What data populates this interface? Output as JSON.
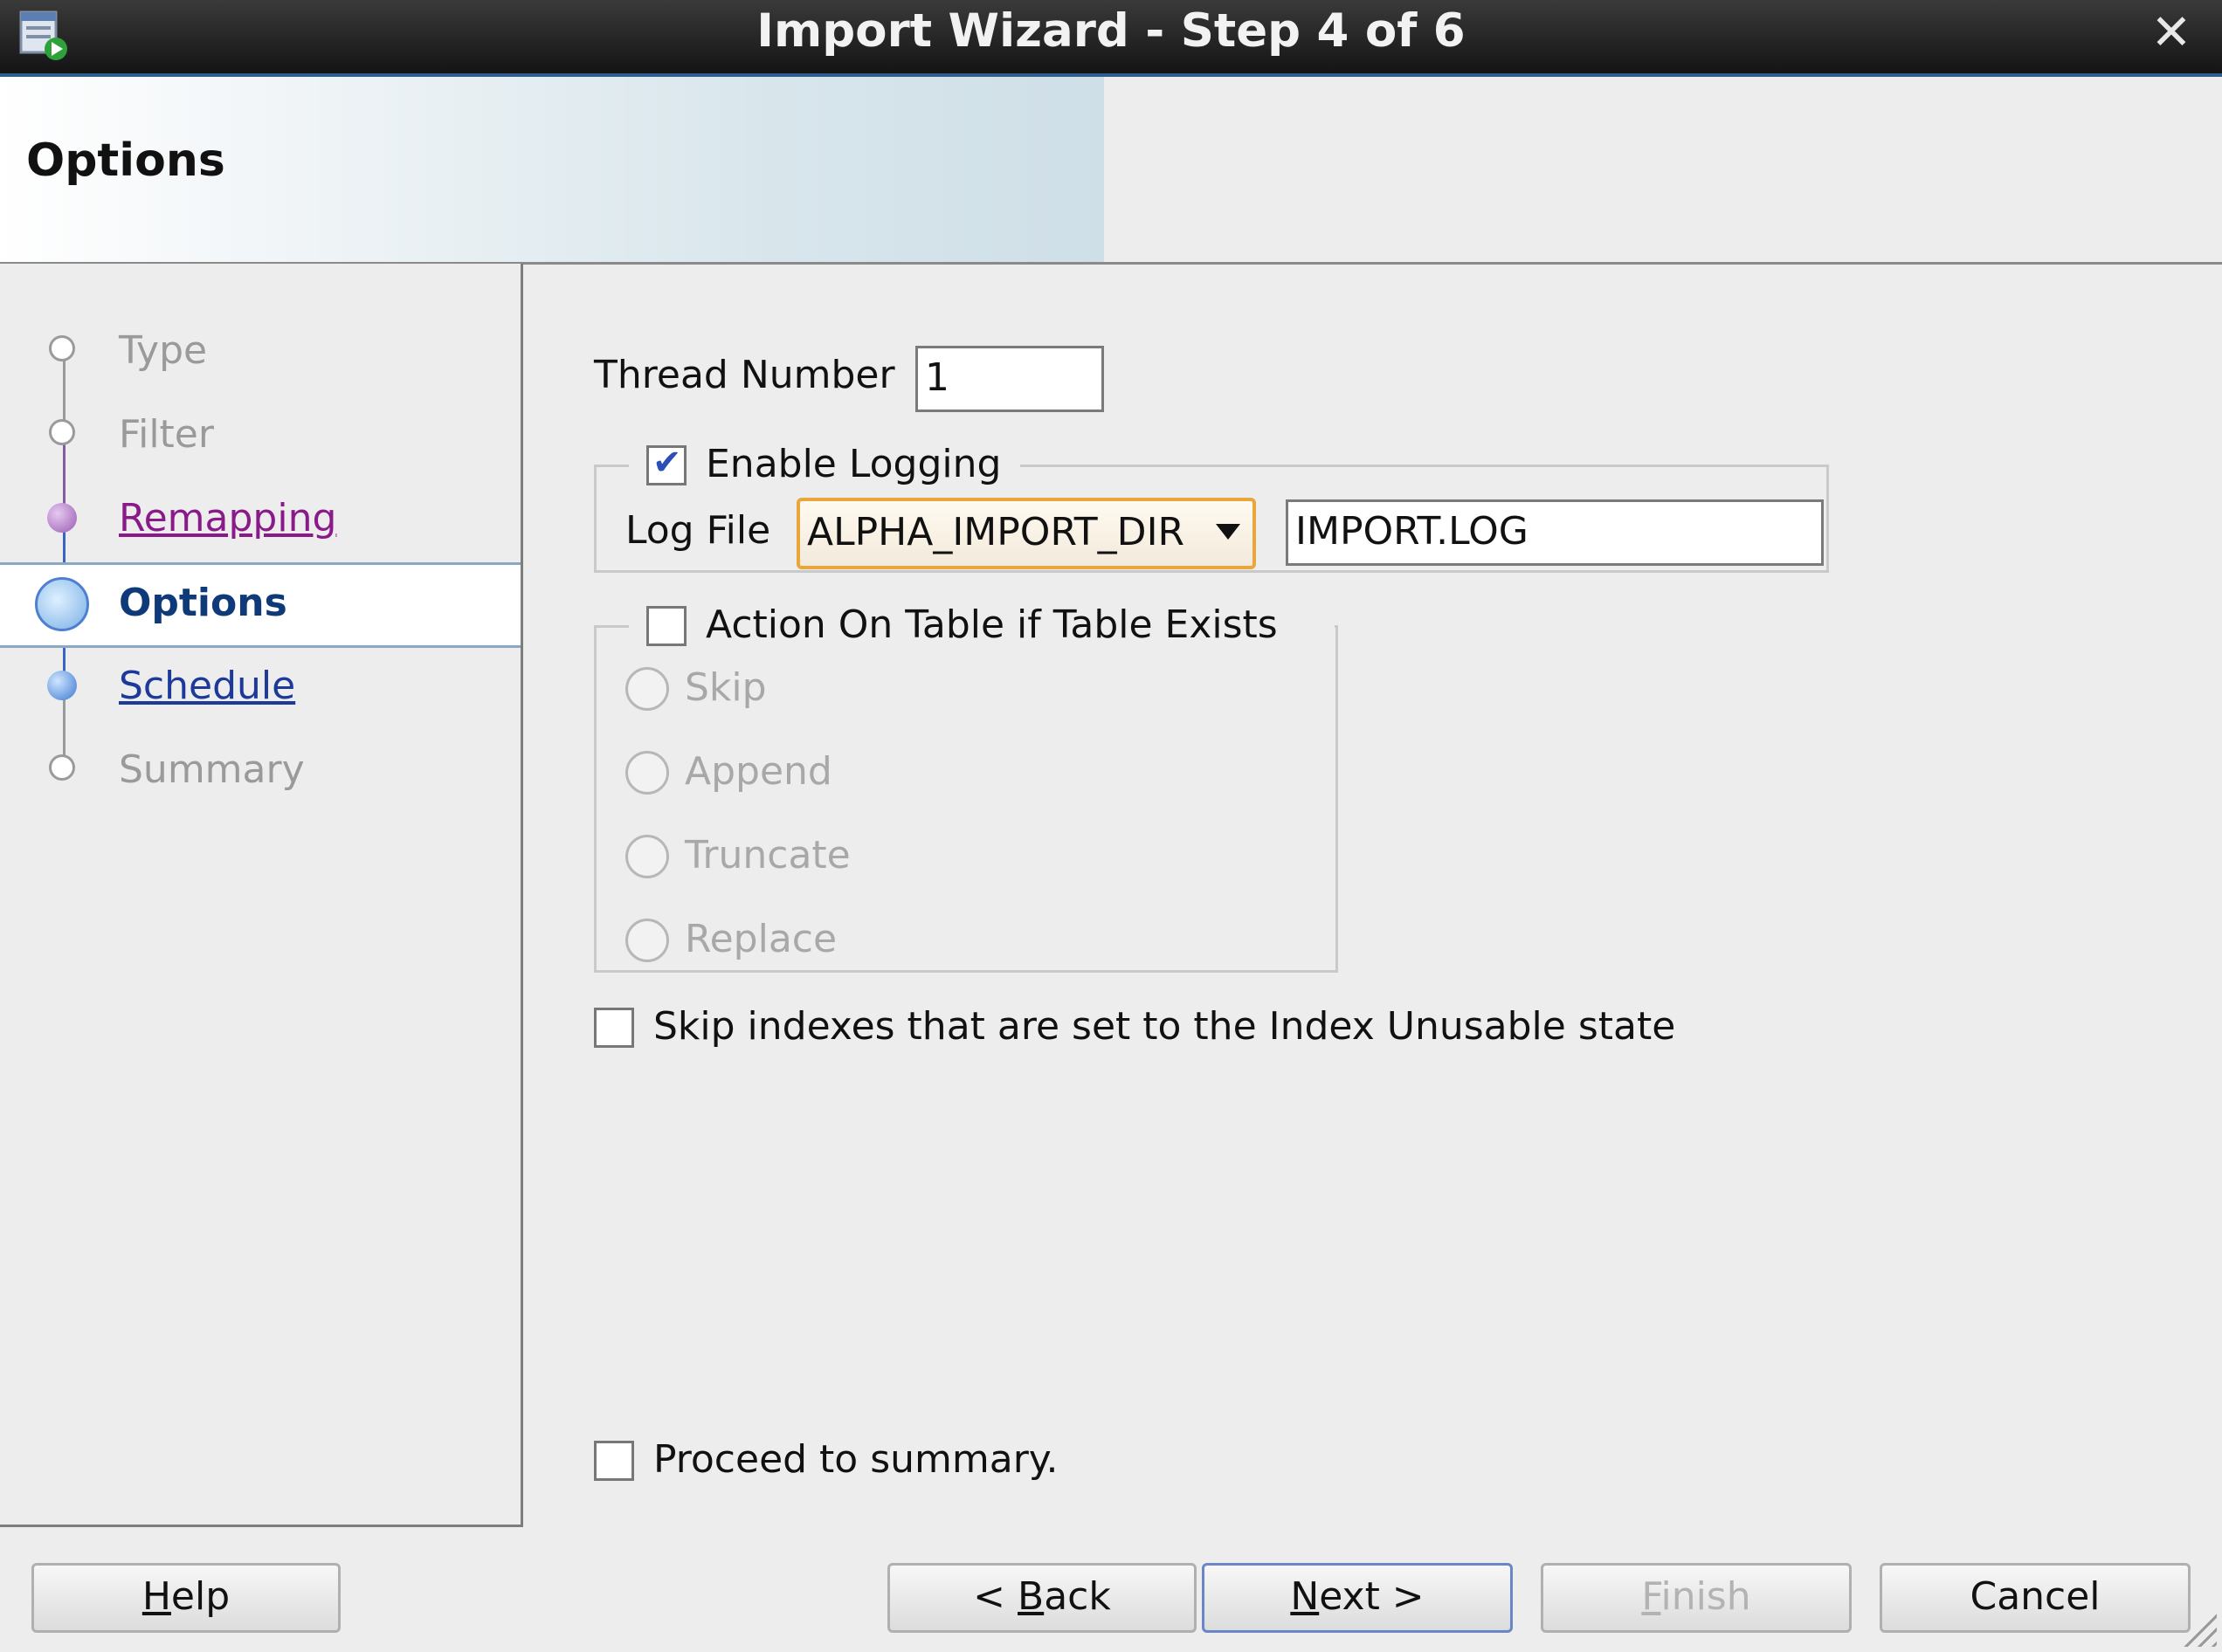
{
  "window": {
    "title": "Import Wizard - Step 4 of 6",
    "app_icon": "wizard-app-icon",
    "close_glyph": "✕"
  },
  "header": {
    "title": "Options"
  },
  "steps": [
    {
      "label": "Type",
      "state": "disabled"
    },
    {
      "label": "Filter",
      "state": "disabled"
    },
    {
      "label": "Remapping",
      "state": "visited"
    },
    {
      "label": "Options",
      "state": "current"
    },
    {
      "label": "Schedule",
      "state": "link"
    },
    {
      "label": "Summary",
      "state": "disabled"
    }
  ],
  "form": {
    "thread_number_label": "Thread Number",
    "thread_number_value": "1",
    "enable_logging_label": "Enable Logging",
    "enable_logging_checked": true,
    "log_file_label": "Log File",
    "log_dir_selected": "ALPHA_IMPORT_DIR",
    "log_file_value": "IMPORT.LOG",
    "action_label": "Action On Table if Table Exists",
    "action_checked": false,
    "action_options": [
      "Skip",
      "Append",
      "Truncate",
      "Replace"
    ],
    "skip_indexes_label": "Skip indexes that are set to the Index Unusable state",
    "proceed_label": "Proceed to summary."
  },
  "buttons": {
    "help_mnemonic": "H",
    "help_rest": "elp",
    "back_prefix": "< ",
    "back_mnemonic": "B",
    "back_rest": "ack",
    "next_mnemonic": "N",
    "next_rest": "ext >",
    "finish_mnemonic": "F",
    "finish_rest": "inish",
    "cancel": "Cancel"
  },
  "colors": {
    "accent_focus": "#e8a63c",
    "link": "#1d3a9a",
    "visited": "#8a1a8a",
    "current_step": "#0f3a7a"
  }
}
